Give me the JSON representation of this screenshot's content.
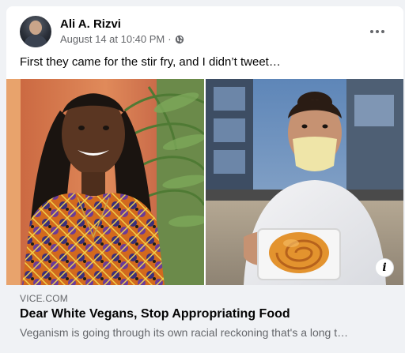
{
  "post": {
    "author": "Ali A. Rizvi",
    "timestamp": "August 14 at 10:40 PM",
    "separator": "·",
    "privacy_icon": "globe-icon",
    "more_icon": "more-options-icon",
    "text": "First they came for the stir fry, and I didn’t tweet…"
  },
  "link_preview": {
    "domain": "VICE.COM",
    "title": "Dear White Vegans, Stop Appropriating Food",
    "description": "Veganism is going through its own racial reckoning that's a long t…",
    "info_icon": "info-icon",
    "info_glyph": "i"
  },
  "colors": {
    "background": "#f0f2f5",
    "card": "#ffffff",
    "primary_text": "#050505",
    "secondary_text": "#65676b"
  }
}
